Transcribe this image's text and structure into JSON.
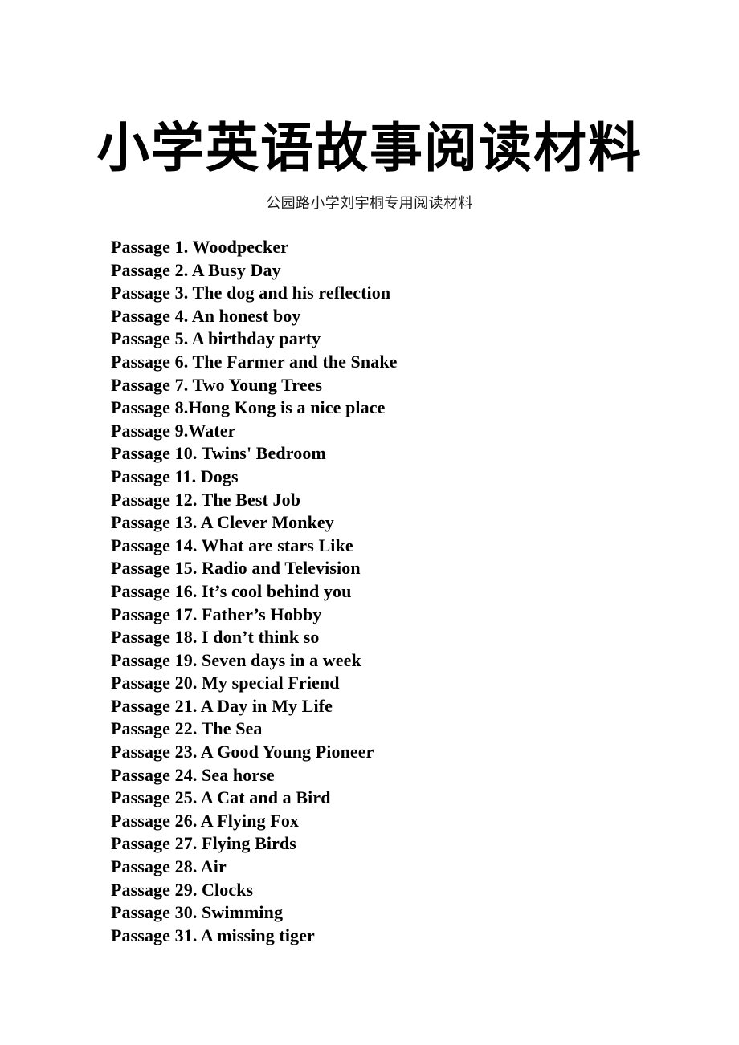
{
  "document": {
    "title": "小学英语故事阅读材料",
    "subtitle": "公园路小学刘宇桐专用阅读材料",
    "background_color": "#ffffff",
    "text_color": "#000000"
  },
  "passages": [
    {
      "text": "Passage 1. Woodpecker"
    },
    {
      "text": "Passage 2. A Busy Day"
    },
    {
      "text": "Passage 3. The dog and his reflection"
    },
    {
      "text": "Passage 4. An honest boy"
    },
    {
      "text": "Passage 5. A birthday party"
    },
    {
      "text": "Passage 6. The Farmer and the Snake"
    },
    {
      "text": "Passage 7. Two Young Trees"
    },
    {
      "text": "Passage 8.Hong Kong is a nice place"
    },
    {
      "text": "Passage 9.Water"
    },
    {
      "text": "Passage 10. Twins' Bedroom"
    },
    {
      "text": "Passage 11. Dogs"
    },
    {
      "text": "Passage 12. The Best Job"
    },
    {
      "text": "Passage 13. A Clever Monkey"
    },
    {
      "text": "Passage 14. What are stars Like"
    },
    {
      "text": "Passage 15. Radio and Television"
    },
    {
      "text": "Passage 16. It’s cool behind you"
    },
    {
      "text": "Passage 17. Father’s Hobby"
    },
    {
      "text": "Passage 18. I don’t think so"
    },
    {
      "text": "Passage 19. Seven days in a week"
    },
    {
      "text": "Passage 20. My special Friend"
    },
    {
      "text": "Passage 21. A Day in My Life"
    },
    {
      "text": "Passage 22. The Sea"
    },
    {
      "text": "Passage 23. A Good Young Pioneer"
    },
    {
      "text": "Passage 24. Sea horse"
    },
    {
      "text": "Passage 25. A Cat and a Bird"
    },
    {
      "text": "Passage 26. A Flying Fox"
    },
    {
      "text": "Passage 27. Flying Birds"
    },
    {
      "text": "Passage 28. Air"
    },
    {
      "text": "Passage 29. Clocks"
    },
    {
      "text": "Passage 30. Swimming"
    },
    {
      "text": "Passage 31. A missing tiger"
    }
  ]
}
